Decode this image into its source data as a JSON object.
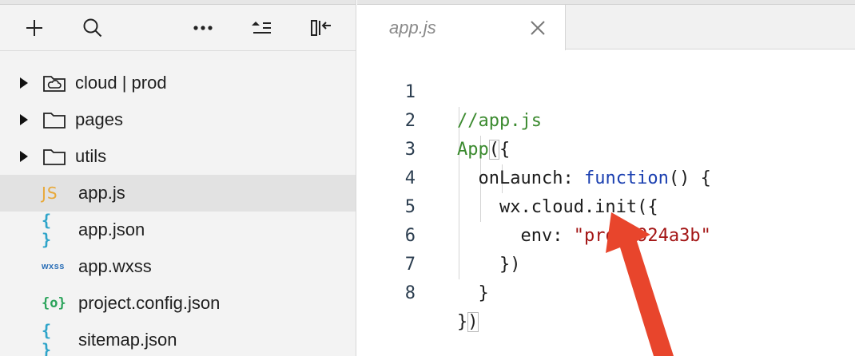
{
  "explorer": {
    "toolbar": {
      "add_icon": "plus-icon",
      "search_icon": "search-icon",
      "more_icon": "more-dots-icon",
      "collapse_icon": "collapse-all-icon",
      "toggle_panel_icon": "collapse-panel-icon"
    },
    "tree": [
      {
        "type": "folder",
        "label": "cloud | prod",
        "icon": "cloud-folder-icon",
        "expanded": false
      },
      {
        "type": "folder",
        "label": "pages",
        "icon": "folder-icon",
        "expanded": false
      },
      {
        "type": "folder",
        "label": "utils",
        "icon": "folder-icon",
        "expanded": false
      },
      {
        "type": "file",
        "label": "app.js",
        "badge": "JS",
        "icon": "js-file-icon",
        "selected": true
      },
      {
        "type": "file",
        "label": "app.json",
        "badge": "{ }",
        "icon": "json-file-icon"
      },
      {
        "type": "file",
        "label": "app.wxss",
        "badge": "wxss",
        "icon": "wxss-file-icon"
      },
      {
        "type": "file",
        "label": "project.config.json",
        "badge": "{o}",
        "icon": "config-file-icon"
      },
      {
        "type": "file",
        "label": "sitemap.json",
        "badge": "{ }",
        "icon": "json-file-icon"
      }
    ]
  },
  "editor": {
    "tab": {
      "label": "app.js",
      "close_icon": "close-icon"
    },
    "lines": [
      {
        "n": "1",
        "t1": "//app.js"
      },
      {
        "n": "2",
        "t1": "App",
        "t2": "(",
        "t3": "{"
      },
      {
        "n": "3",
        "t1": "  onLaunch: ",
        "t2": "function",
        "t3": "() {"
      },
      {
        "n": "4",
        "t1": "    wx.cloud.init({"
      },
      {
        "n": "5",
        "t1": "      env: ",
        "t2": "\"prod-924a3b\""
      },
      {
        "n": "6",
        "t1": "    })"
      },
      {
        "n": "7",
        "t1": "  }"
      },
      {
        "n": "8",
        "t1": "}",
        "t2": ")"
      }
    ]
  },
  "colors": {
    "comment": "#3b8a2f",
    "keyword": "#1a3fb0",
    "string": "#a31515",
    "annotation_arrow": "#e8452c"
  }
}
